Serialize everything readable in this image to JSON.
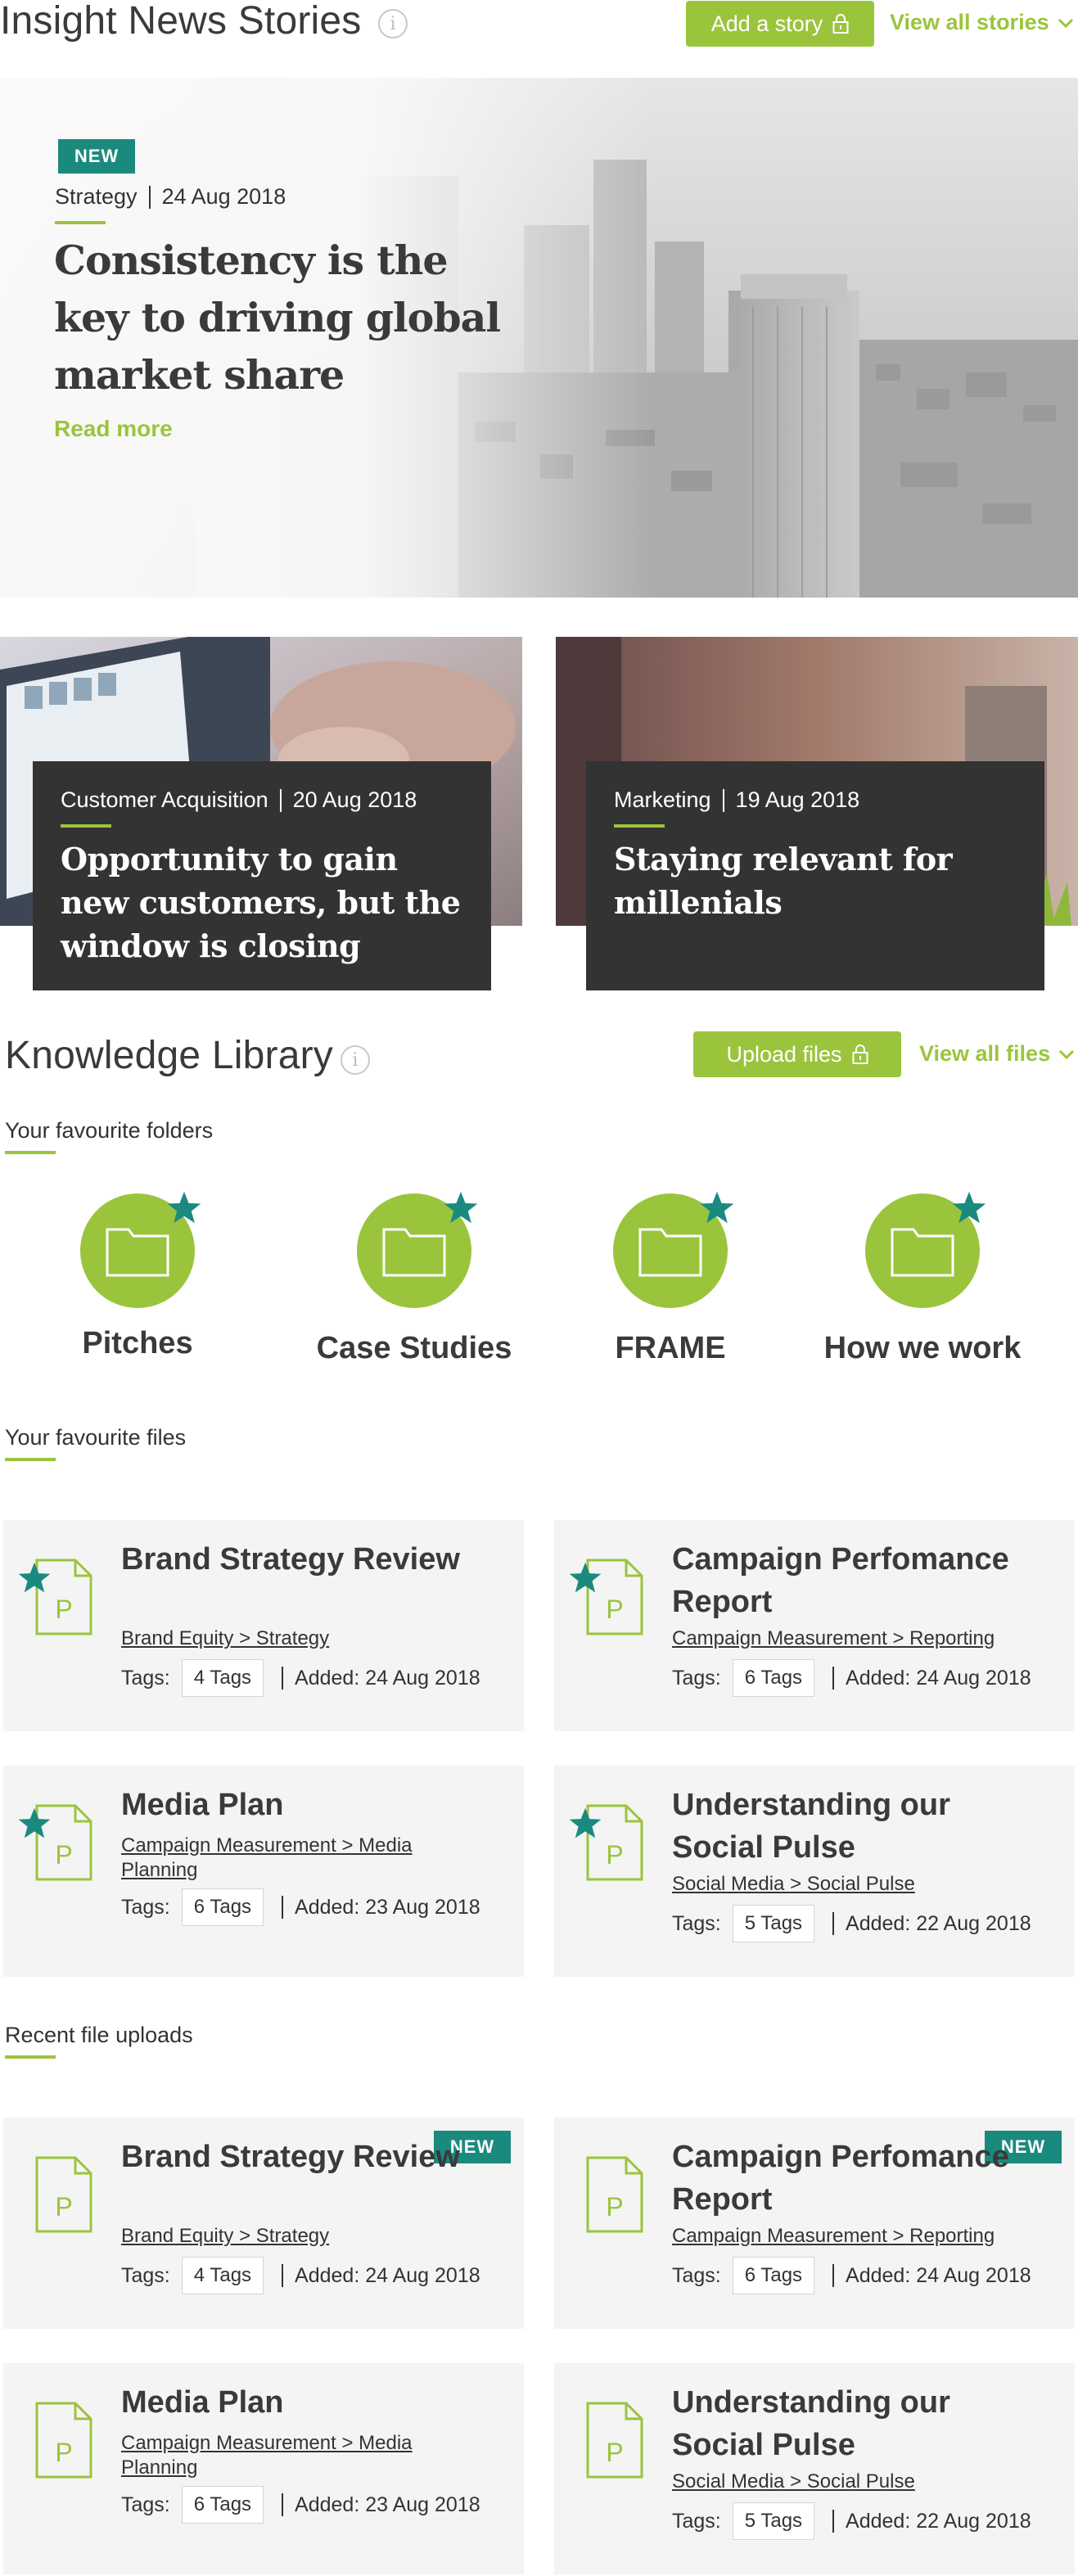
{
  "insight": {
    "title": "Insight News Stories",
    "add_story": "Add a story",
    "view_all": "View all stories"
  },
  "hero": {
    "badge": "NEW",
    "category": "Strategy",
    "date": "24 Aug 2018",
    "title": "Consistency is the key to driving global market share",
    "read_more": "Read more"
  },
  "stories": [
    {
      "category": "Customer Acquisition",
      "date": "20 Aug 2018",
      "title": "Opportunity to gain new customers, but the window is closing"
    },
    {
      "category": "Marketing",
      "date": "19 Aug 2018",
      "title": "Staying relevant for millenials"
    }
  ],
  "library": {
    "title": "Knowledge Library",
    "upload": "Upload files",
    "view_all": "View all files"
  },
  "folders": {
    "heading": "Your favourite folders",
    "items": [
      "Pitches",
      "Case Studies",
      "FRAME",
      "How we work"
    ]
  },
  "fav_files": {
    "heading": "Your favourite files",
    "items": [
      {
        "title": "Brand Strategy Review",
        "path": "Brand Equity > Strategy",
        "tags_label": "Tags:",
        "tags": "4 Tags",
        "added": "Added: 24 Aug 2018"
      },
      {
        "title": "Campaign Perfomance Report",
        "path": "Campaign Measurement > Reporting",
        "tags_label": "Tags:",
        "tags": "6 Tags",
        "added": "Added: 24 Aug 2018"
      },
      {
        "title": "Media Plan",
        "path": "Campaign Measurement > Media Planning",
        "tags_label": "Tags:",
        "tags": "6 Tags",
        "added": "Added: 23 Aug 2018"
      },
      {
        "title": "Understanding our Social Pulse",
        "path": "Social Media > Social Pulse",
        "tags_label": "Tags:",
        "tags": "5 Tags",
        "added": "Added: 22 Aug 2018"
      }
    ]
  },
  "recent_files": {
    "heading": "Recent file uploads",
    "badge": "NEW",
    "items": [
      {
        "title": "Brand Strategy Review",
        "path": "Brand Equity > Strategy",
        "tags_label": "Tags:",
        "tags": "4 Tags",
        "added": "Added: 24 Aug 2018"
      },
      {
        "title": "Campaign Perfomance Report",
        "path": "Campaign Measurement > Reporting",
        "tags_label": "Tags:",
        "tags": "6 Tags",
        "added": "Added: 24 Aug 2018"
      },
      {
        "title": "Media Plan",
        "path": "Campaign Measurement > Media Planning",
        "tags_label": "Tags:",
        "tags": "6 Tags",
        "added": "Added: 23 Aug 2018"
      },
      {
        "title": "Understanding our Social Pulse",
        "path": "Social Media > Social Pulse",
        "tags_label": "Tags:",
        "tags": "5 Tags",
        "added": "Added: 22 Aug 2018"
      }
    ]
  },
  "colors": {
    "accent": "#9bc43d",
    "badge": "#1b8a7e",
    "dark_box": "#333333",
    "card_bg": "#f4f4f4"
  },
  "icons": [
    "info-icon",
    "lock-icon",
    "chevron-down-icon",
    "folder-icon",
    "star-icon",
    "file-icon"
  ]
}
